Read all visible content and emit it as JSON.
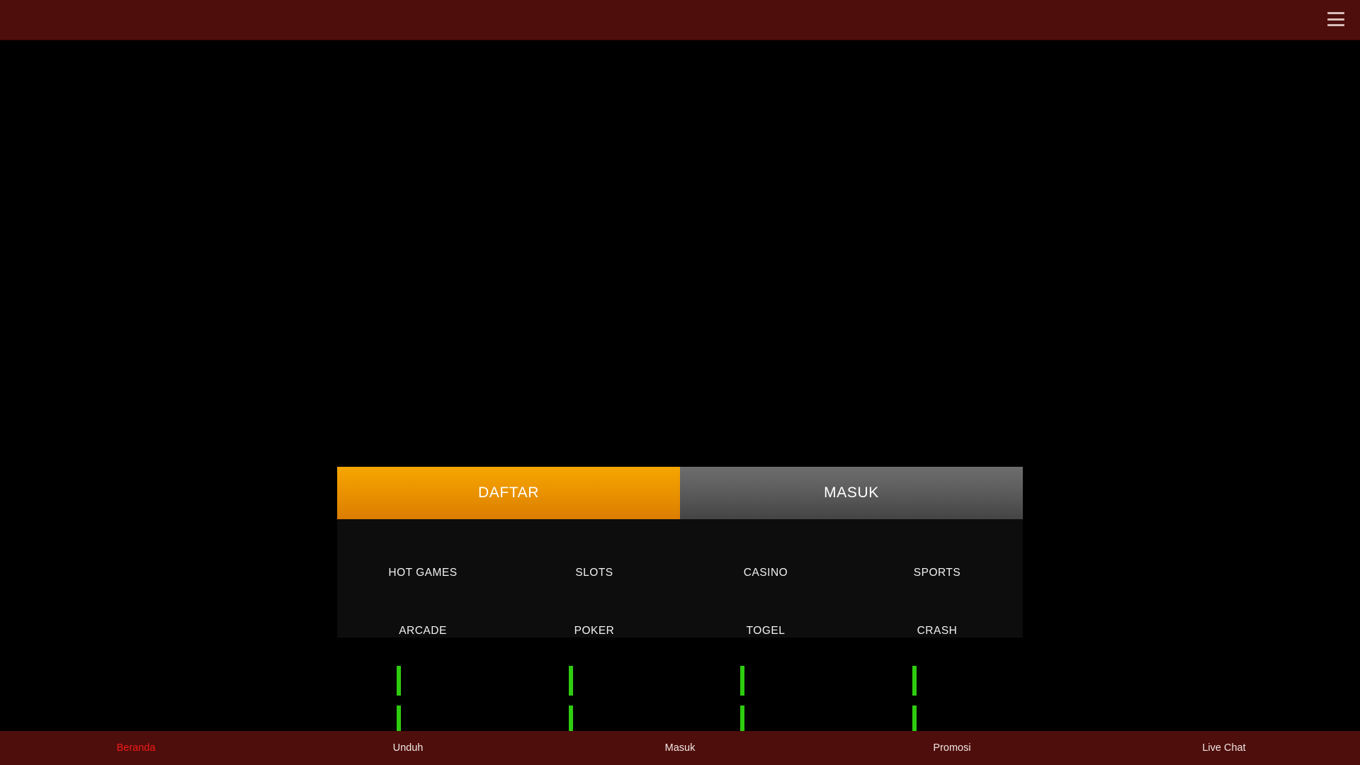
{
  "topbar": {
    "menu_icon": "hamburger-menu-icon",
    "background_color": "#4e0e0b"
  },
  "panel": {
    "auth": {
      "register_label": "DAFTAR",
      "login_label": "MASUK",
      "register_color": "#eb9400",
      "login_color": "#5d5d5d"
    },
    "categories": [
      {
        "label": "HOT GAMES"
      },
      {
        "label": "SLOTS"
      },
      {
        "label": "CASINO"
      },
      {
        "label": "SPORTS"
      },
      {
        "label": "ARCADE"
      },
      {
        "label": "POKER"
      },
      {
        "label": "TOGEL"
      },
      {
        "label": "CRASH"
      }
    ]
  },
  "loading": {
    "indicator_color": "#2ecc0f",
    "columns": 4
  },
  "bottom_nav": {
    "active_color": "#f21a18",
    "items": [
      {
        "label": "Beranda",
        "active": true
      },
      {
        "label": "Unduh",
        "active": false
      },
      {
        "label": "Masuk",
        "active": false
      },
      {
        "label": "Promosi",
        "active": false
      },
      {
        "label": "Live Chat",
        "active": false
      }
    ]
  }
}
